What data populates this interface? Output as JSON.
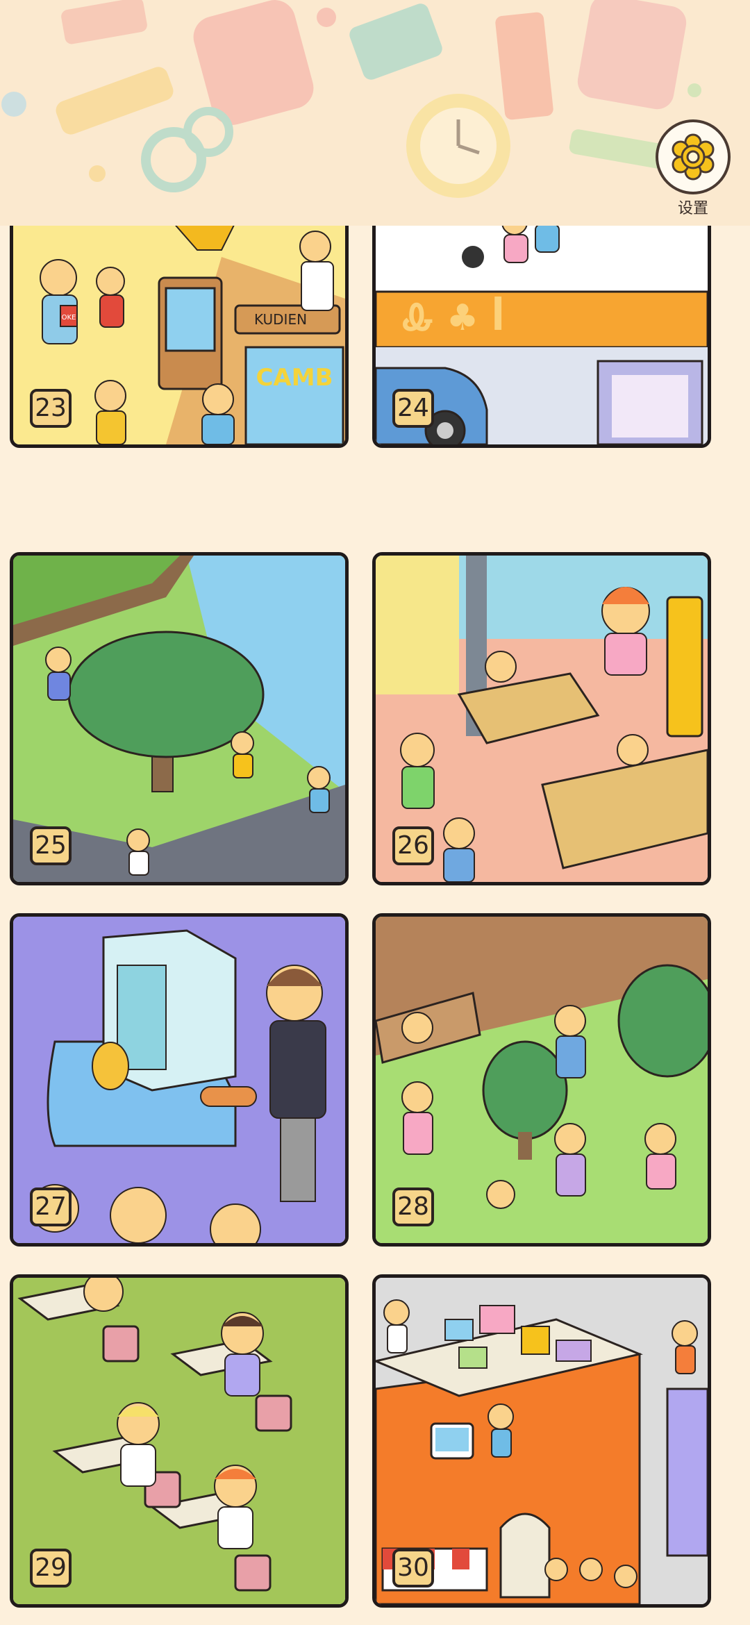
{
  "header": {
    "settings_label": "设置",
    "settings_icon": "gear-flower-icon",
    "accent": "#f6c21c"
  },
  "levels": [
    {
      "number": "23",
      "scene": "arcade"
    },
    {
      "number": "24",
      "scene": "rooftop"
    },
    {
      "number": "25",
      "scene": "park"
    },
    {
      "number": "26",
      "scene": "office"
    },
    {
      "number": "27",
      "scene": "food-court"
    },
    {
      "number": "28",
      "scene": "garden"
    },
    {
      "number": "29",
      "scene": "classroom"
    },
    {
      "number": "30",
      "scene": "toy-shop"
    }
  ],
  "scene_text": {
    "sign_kudien": "KUDIEN",
    "sign_camb": "CAMB",
    "book_label": "OKE"
  }
}
